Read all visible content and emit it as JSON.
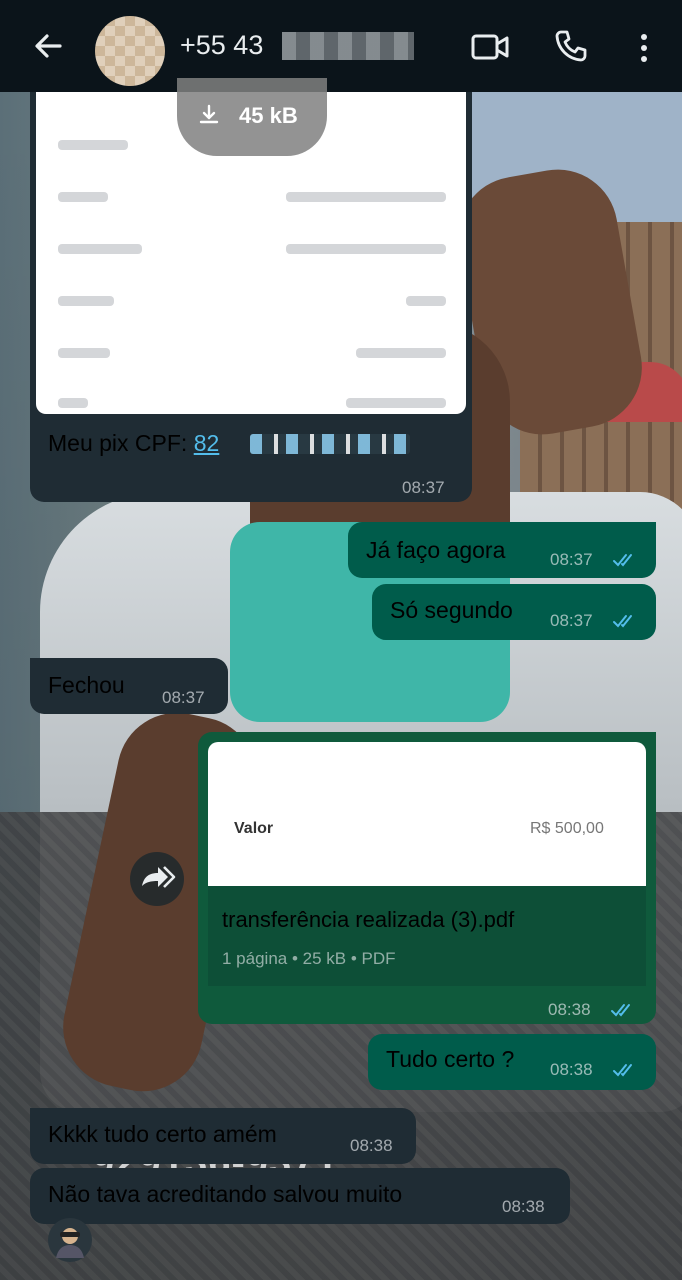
{
  "header": {
    "contact_name": "+55 43",
    "colors": {
      "background": "#0b141a",
      "text": "#e9edef"
    }
  },
  "messages": {
    "image_message": {
      "download_label": "45 kB",
      "caption_prefix": "Meu pix CPF:",
      "caption_link": "82",
      "time": "08:37"
    },
    "out_1": {
      "text": "Já faço agora",
      "time": "08:37"
    },
    "out_2": {
      "text": "Só segundo",
      "time": "08:37"
    },
    "in_1": {
      "text": "Fechou",
      "time": "08:37"
    },
    "document": {
      "preview_label": "Valor",
      "preview_amount": "R$ 500,00",
      "file_name": "transferência realizada  (3).pdf",
      "file_meta": "1 página • 25 kB • PDF",
      "time": "08:38"
    },
    "out_3": {
      "text": "Tudo certo ?",
      "time": "08:38"
    },
    "in_2": {
      "text": "Kkkk tudo certo amém",
      "time": "08:38"
    },
    "in_3": {
      "text": "Não tava acreditando salvou muito",
      "time": "08:38"
    }
  },
  "wallpaper": {
    "watermark": "929136-9371"
  },
  "colors": {
    "incoming_bubble": "#1f2c34",
    "outgoing_bubble": "#005c4b",
    "read_ticks": "#53bdeb",
    "link": "#53bdeb"
  },
  "icons": [
    "back-arrow-icon",
    "video-call-icon",
    "phone-icon",
    "more-vert-icon",
    "download-icon",
    "double-check-icon",
    "forward-icon",
    "emoji-avatar-icon"
  ]
}
